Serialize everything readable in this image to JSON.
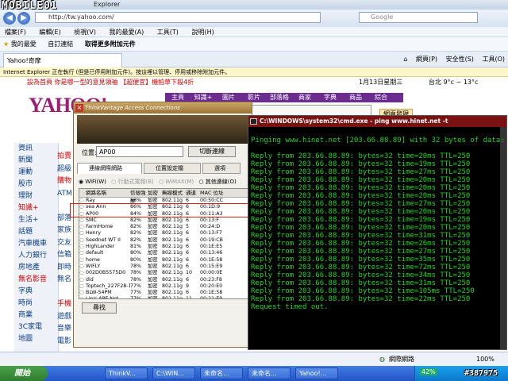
{
  "ie": {
    "title": "Explorer",
    "url": "http://tw.yahoo.com/",
    "search_placeholder": "Google",
    "menus": [
      "檔案(F)",
      "編輯(E)",
      "檢視(V)",
      "我的最愛(A)",
      "工具(T)",
      "說明(H)"
    ],
    "favorites": [
      "我的最愛",
      "自訂連結",
      "取得更多附加元件"
    ],
    "tab_title": "Yahoo!奇摩",
    "tools": [
      "網頁(P)",
      "安全性(S)",
      "工具(O)"
    ],
    "infobar": "Internet Explorer 正在執行 (但是已停用附加元件)。按這裡以管理、停用或移除附加元件。"
  },
  "yahoo": {
    "header_left": "設為首頁  你是哪一型的意見領袖 【超便宜】機拍草下殺4折",
    "date": "1月13日星期三",
    "weather": "台北  9°c ~ 13°c",
    "logo": "YAHOO!",
    "nav": [
      "主頁",
      "知識+",
      "圖片",
      "影片",
      "部落格",
      "商家",
      "字典",
      "商品",
      "綜合"
    ],
    "top_badge": "網頁發現",
    "left_menu": [
      "資訊",
      "新聞",
      "運動",
      "股市",
      "理財",
      "知識+",
      "生活+",
      "話題",
      "汽車機車",
      "人力銀行",
      "房地產",
      "無名影音",
      "字典",
      "時尚",
      "商業",
      "3C家電",
      "地圖"
    ],
    "col2": [
      "拍賣",
      "超級",
      "購物",
      "ATM",
      "",
      "部落",
      "家族",
      "交友",
      "信箱",
      "即時",
      "無名",
      "",
      "手機",
      "遊戲",
      "音樂",
      "電影"
    ]
  },
  "ac": {
    "title": "ThinkVantage Access Connections",
    "location_label": "位置:",
    "location_value": "AP00",
    "switch_button": "切斷連線",
    "tabs": [
      "連線網際網路",
      "位置設定檔",
      "選項"
    ],
    "filter": [
      "WiFi(W)",
      "行動式寬頻(B)",
      "WiMAX(M)",
      "其他連線(O)"
    ],
    "headers": [
      "",
      "網路名稱",
      "信號強度",
      "加密",
      "無線模式",
      "通道",
      "MAC 位址"
    ],
    "rows": [
      [
        "",
        "Ray",
        "88%",
        "加密",
        "802.11g",
        "6",
        "00:50:CC"
      ],
      [
        "",
        "sea Ann",
        "86%",
        "加密",
        "802.11g",
        "6",
        "00:1D:9"
      ],
      [
        "",
        "AP00",
        "84%",
        "加密",
        "802.11g",
        "6",
        "00:11:A3"
      ],
      [
        "",
        "SMC",
        "82%",
        "加密",
        "802.11g",
        "6",
        "00:13:F"
      ],
      [
        "",
        "FarmHome",
        "82%",
        "加密",
        "802.11g",
        "5",
        "00:24:D"
      ],
      [
        "",
        "Henry",
        "82%",
        "加密",
        "802.11g",
        "6",
        "00:13:F7"
      ],
      [
        "",
        "Seednet WT II",
        "82%",
        "加密",
        "802.11g",
        "6",
        "00:19:CB"
      ],
      [
        "",
        "HighLander",
        "81%",
        "加密",
        "802.11g",
        "6",
        "00:1E:E5"
      ],
      [
        "",
        "default",
        "80%",
        "加密",
        "802.11g",
        "6",
        "00:13:46"
      ],
      [
        "",
        "home",
        "80%",
        "加密",
        "802.11g",
        "6",
        "00:1E:58"
      ],
      [
        "",
        "WIFLY",
        "78%",
        "加密",
        "802.11g",
        "6",
        "00:15:E9"
      ],
      [
        "",
        "002D0B5575D0",
        "78%",
        "加密",
        "802.11g",
        "10",
        "00:00:0E"
      ],
      [
        "",
        "did",
        "78%",
        "加密",
        "802.11g",
        "6",
        "00:23:F8"
      ],
      [
        "",
        "Toptech_227F28-1",
        "77%",
        "加密",
        "802.11g",
        "9",
        "00:20:E0"
      ],
      [
        "",
        "BLW-54PM",
        "77%",
        "加密",
        "802.11g",
        "6",
        "00:1E:58"
      ],
      [
        "",
        "Lin's APE Net",
        "77%",
        "加密",
        "802.11g",
        "11",
        "00:21:E9"
      ]
    ],
    "find_button": "尋找"
  },
  "cmd": {
    "title": "C:\\WINDOWS\\system32\\cmd.exe - ping www.hinet.net -t",
    "lines": [
      "Pinging www.hinet.net [203.66.88.89] with 32 bytes of data:",
      "",
      "Reply from 203.66.88.89: bytes=32 time=20ms TTL=250",
      "Reply from 203.66.88.89: bytes=32 time=19ms TTL=250",
      "Reply from 203.66.88.89: bytes=32 time=27ms TTL=250",
      "Reply from 203.66.88.89: bytes=32 time=20ms TTL=250",
      "Reply from 203.66.88.89: bytes=32 time=20ms TTL=250",
      "Reply from 203.66.88.89: bytes=32 time=20ms TTL=250",
      "Reply from 203.66.88.89: bytes=32 time=27ms TTL=250",
      "Reply from 203.66.88.89: bytes=32 time=20ms TTL=250",
      "Reply from 203.66.88.89: bytes=32 time=19ms TTL=250",
      "Reply from 203.66.88.89: bytes=32 time=20ms TTL=250",
      "Reply from 203.66.88.89: bytes=32 time=31ms TTL=250",
      "Reply from 203.66.88.89: bytes=32 time=26ms TTL=250",
      "Reply from 203.66.88.89: bytes=32 time=27ms TTL=250",
      "Reply from 203.66.88.89: bytes=32 time=35ms TTL=250",
      "Reply from 203.66.88.89: bytes=32 time=72ms TTL=250",
      "Reply from 203.66.88.89: bytes=32 time=34ms TTL=250",
      "Reply from 203.66.88.89: bytes=32 time=31ms TTL=250",
      "Reply from 203.66.88.89: bytes=32 time=105ms TTL=250",
      "Reply from 203.66.88.89: bytes=32 time=22ms TTL=250",
      "Request timed out."
    ]
  },
  "status": {
    "zone": "網際網路",
    "zoom": "100%"
  },
  "taskbar": {
    "start": "開始",
    "tasks": [
      "ThinkV...",
      "C:\\WIN...",
      "未命名...",
      "未命名...",
      "Yahoo!..."
    ],
    "battery": "42%",
    "watermark": "#387975",
    "logo_watermark": "MOBILE01"
  },
  "colors": {
    "cmd_text": "#22d522",
    "highlight": "#d0211b",
    "yahoo_purple": "#6b2b8f"
  }
}
